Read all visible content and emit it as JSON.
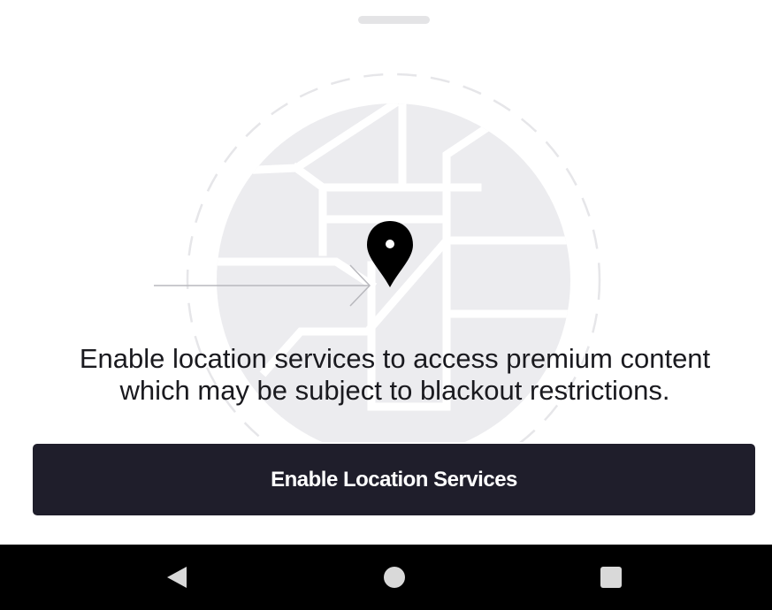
{
  "sheet": {
    "handle_icon": "drag-handle"
  },
  "illustration": {
    "map_icon": "map-illustration",
    "pin_icon": "location-pin-icon",
    "arrow_icon": "arrow-right-icon"
  },
  "prompt": {
    "line1": "Enable location services to access premium content",
    "line2": "which may be subject to blackout restrictions."
  },
  "button": {
    "label": "Enable Location Services",
    "background": "#1f1e2b",
    "text_color": "#ffffff"
  },
  "nav": {
    "back_icon": "back-triangle-icon",
    "home_icon": "home-circle-icon",
    "recents_icon": "recents-square-icon"
  }
}
